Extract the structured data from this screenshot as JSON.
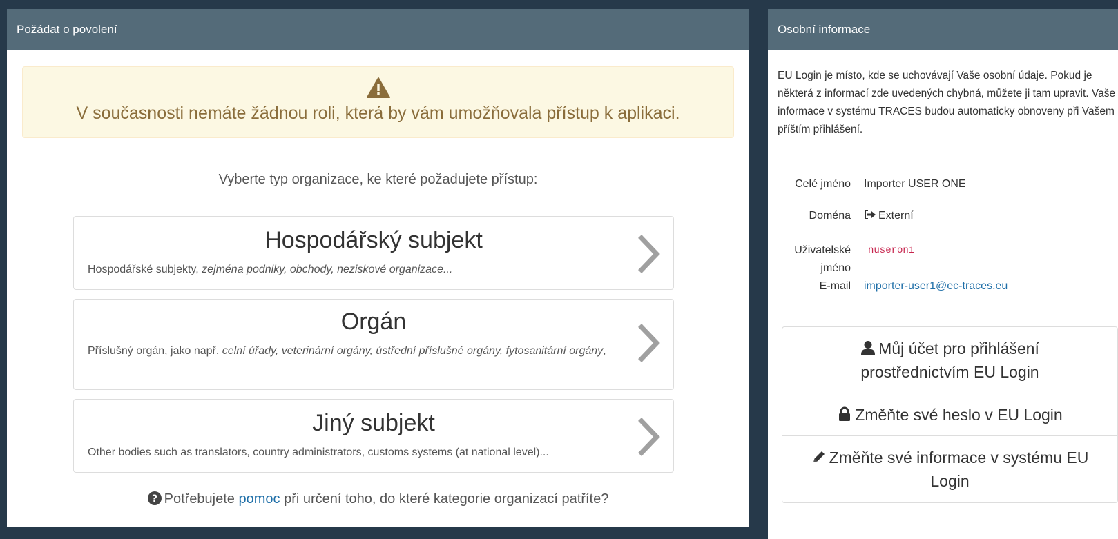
{
  "left_panel": {
    "title": "Požádat o povolení",
    "alert": {
      "icon": "warning-triangle-icon",
      "text": "V současnosti nemáte žádnou roli, která by vám umožňovala přístup k aplikaci."
    },
    "prompt": "Vyberte typ organizace, ke které požadujete přístup:",
    "cards": [
      {
        "title": "Hospodářský subjekt",
        "desc_plain": "Hospodářské subjekty, ",
        "desc_italic": "zejména podniky, obchody, neziskové organizace..."
      },
      {
        "title": "Orgán",
        "desc_plain": "Příslušný orgán, jako např. ",
        "desc_italic": "celní úřady, veterinární orgány, ústřední příslušné orgány, fytosanitární orgány",
        "desc_tail": ","
      },
      {
        "title": "Jiný subjekt",
        "desc_plain": "Other bodies such as translators, country administrators, customs systems (at national level)...",
        "desc_italic": ""
      }
    ],
    "help": {
      "before": "Potřebujete ",
      "link": "pomoc",
      "after": " při určení toho, do které kategorie organizací patříte?"
    }
  },
  "right_panel": {
    "title": "Osobní informace",
    "intro": "EU Login je místo, kde se uchovávají Vaše osobní údaje. Pokud je některá z informací zde uvedených chybná, můžete ji tam upravit. Vaše informace v systému TRACES budou automaticky obnoveny při Vašem příštím přihlášení.",
    "fields": {
      "name_label": "Celé jméno",
      "name_value": "Importer USER ONE",
      "domain_label": "Doména",
      "domain_value": "Externí",
      "username_label_1": "Uživatelské",
      "username_label_2": "jméno",
      "username_value": "nuseroni",
      "email_label": "E-mail",
      "email_value": "importer-user1@ec-traces.eu"
    },
    "buttons": {
      "account_1": "Můj účet pro přihlášení",
      "account_2": "prostřednictvím EU Login",
      "password": "Změňte své heslo v EU Login",
      "info_1": "Změňte své informace v systému EU",
      "info_2": "Login"
    }
  },
  "colors": {
    "header_bg": "#546b79",
    "page_bg": "#26394a",
    "alert_text": "#8a6d3b",
    "alert_bg": "#fcf8e3",
    "link": "#1f6fa8",
    "code": "#c7254e"
  }
}
